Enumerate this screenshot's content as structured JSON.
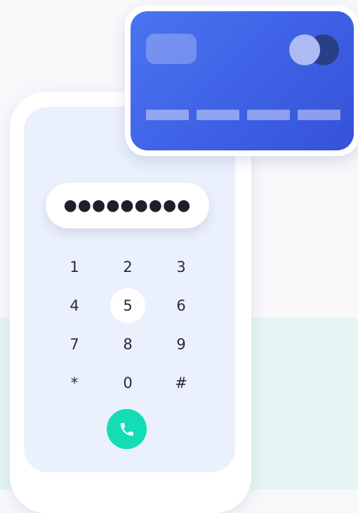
{
  "pin": {
    "masked_value": "●●●●●●●●●"
  },
  "keypad": {
    "keys": [
      "1",
      "2",
      "3",
      "4",
      "5",
      "6",
      "7",
      "8",
      "9",
      "*",
      "0",
      "#"
    ],
    "active_key": "5"
  },
  "call_button": {
    "icon": "phone-icon",
    "color": "#14ddb5"
  },
  "card": {
    "gradient_start": "#4b74f0",
    "gradient_end": "#3552d9",
    "brand_logo": "two-circles-logo"
  },
  "colors": {
    "page_top": "#f8f8fb",
    "page_bottom": "#e5f5f3",
    "screen": "#ebf0fd"
  }
}
